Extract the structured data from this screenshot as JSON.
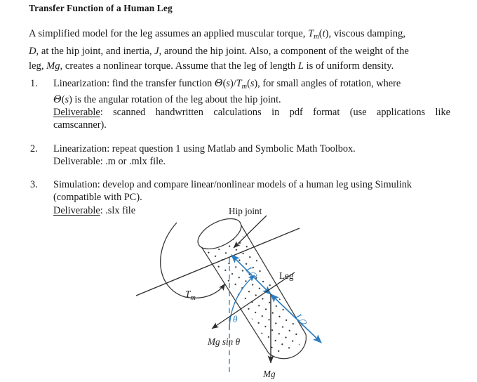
{
  "document": {
    "title": "Transfer Function of a Human Leg",
    "intro_lines": [
      "A simplified model for the leg assumes an applied muscular torque, T_m(t), viscous damping,",
      "D, at the hip joint, and inertia, J, around the hip joint. Also, a component of the weight of the",
      "leg, Mg, creates a nonlinear torque. Assume that the leg of length L is of uniform density."
    ],
    "tasks": [
      {
        "number": "1.",
        "lines": [
          "Linearization: find the transfer function Θ(s)/T_m(s), for small angles of rotation, where",
          "Θ(s) is the angular rotation of the leg about the hip joint."
        ],
        "deliverable_label": "Deliverable",
        "deliverable_lines": [
          ": scanned handwritten calculations in pdf format (use applications like",
          "camscanner)."
        ],
        "deliverable_underlined": true
      },
      {
        "number": "2.",
        "lines": [
          "Linearization: repeat question 1 using Matlab and Symbolic Math Toolbox."
        ],
        "deliverable_label": "Deliverable",
        "deliverable_lines": [
          ": .m or .mlx file."
        ],
        "deliverable_underlined": false
      },
      {
        "number": "3.",
        "lines": [
          "Simulation: develop and compare linear/nonlinear models of a human leg using Simulink",
          "(compatible with PC)."
        ],
        "deliverable_label": "Deliverable",
        "deliverable_lines": [
          ": .slx file"
        ],
        "deliverable_underlined": true
      }
    ]
  },
  "figure": {
    "name": "human-leg-free-body-diagram",
    "labels": {
      "hip_joint": "Hip joint",
      "leg": "Leg",
      "torque": "T",
      "torque_sub": "m",
      "theta": "θ",
      "mg_sin_theta_prefix": "Mg",
      "mg_sin_theta_rest": "sin",
      "mg_sin_theta_symbol": "θ",
      "mg": "Mg",
      "half_length_upper": "L/2",
      "half_length_lower": "L/2"
    },
    "colors": {
      "accent_blue": "#2b7cc0",
      "line_dark": "#3a3a38",
      "text": "#20201f"
    }
  }
}
